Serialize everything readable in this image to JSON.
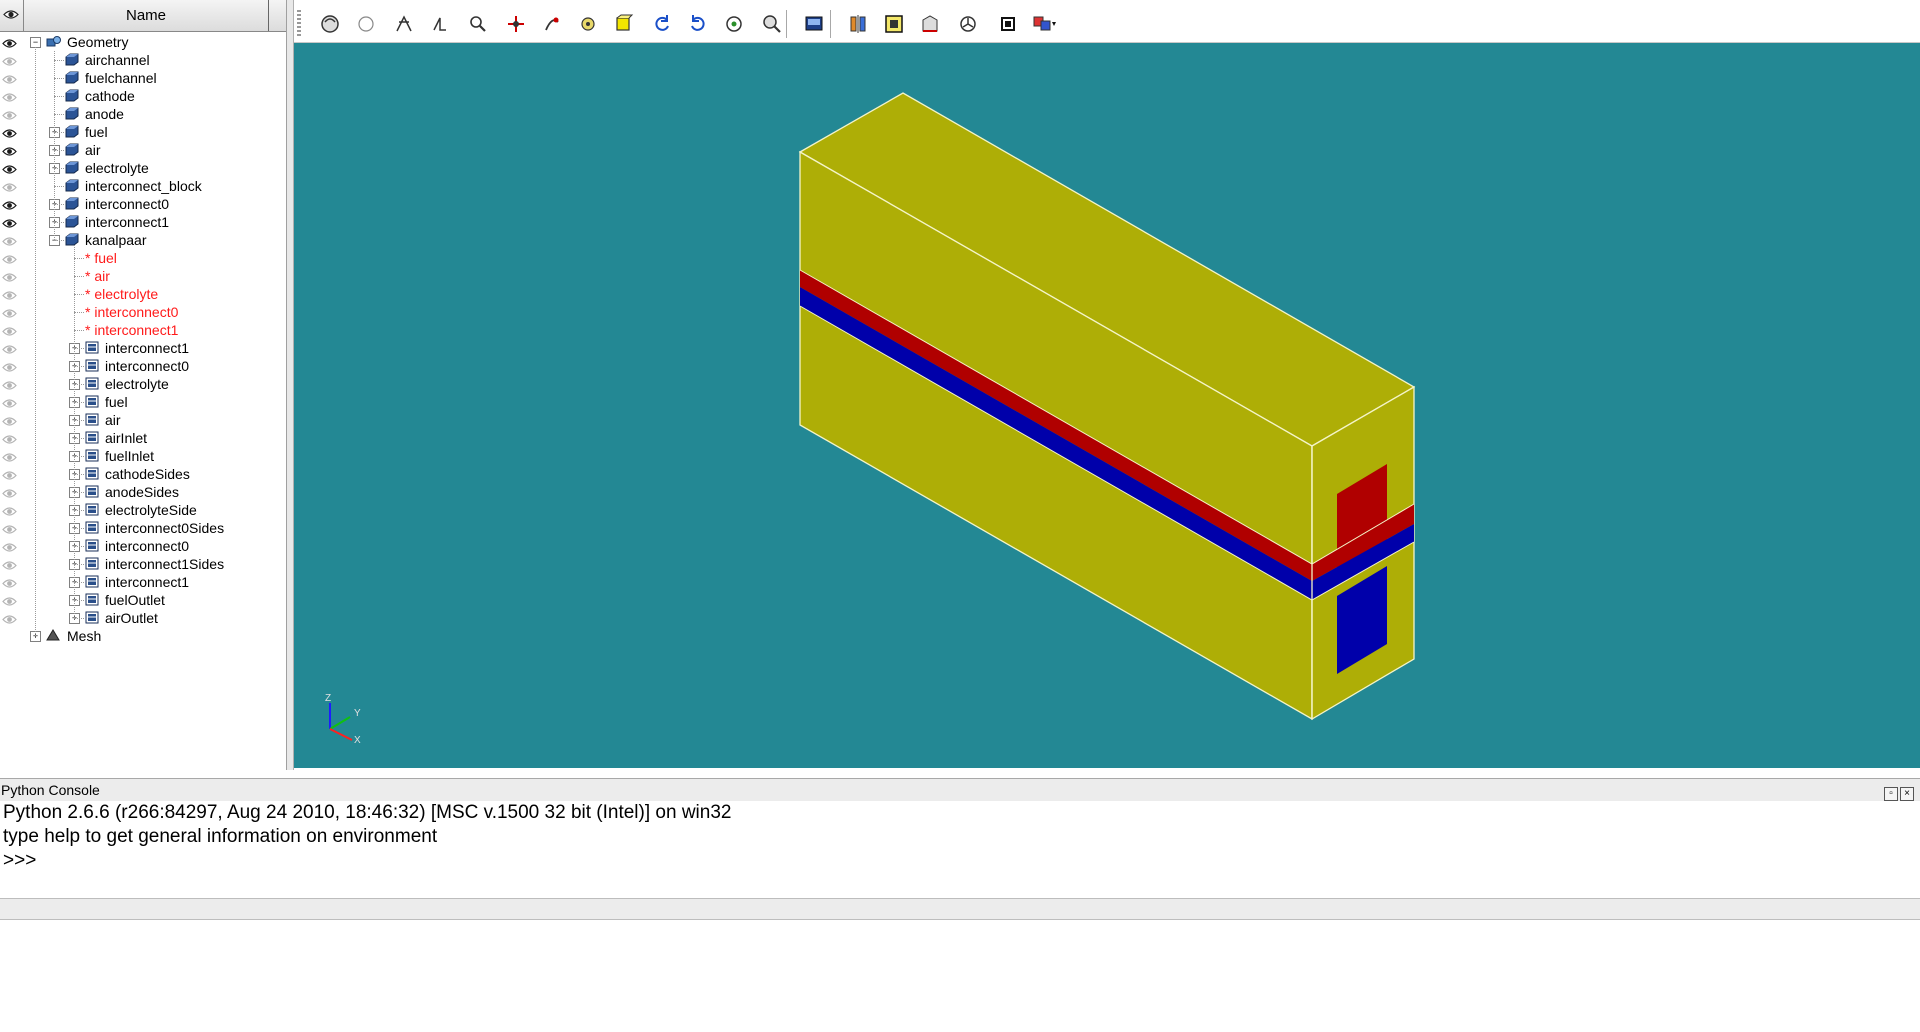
{
  "browser": {
    "header_name": "Name",
    "rows": [
      {
        "label": "Geometry",
        "red": false,
        "eye": "dark"
      },
      {
        "label": "airchannel",
        "red": false,
        "eye": "light"
      },
      {
        "label": "fuelchannel",
        "red": false,
        "eye": "light"
      },
      {
        "label": "cathode",
        "red": false,
        "eye": "light"
      },
      {
        "label": "anode",
        "red": false,
        "eye": "light"
      },
      {
        "label": "fuel",
        "red": false,
        "eye": "dark"
      },
      {
        "label": "air",
        "red": false,
        "eye": "dark"
      },
      {
        "label": "electrolyte",
        "red": false,
        "eye": "dark"
      },
      {
        "label": "interconnect_block",
        "red": false,
        "eye": "light"
      },
      {
        "label": "interconnect0",
        "red": false,
        "eye": "dark"
      },
      {
        "label": "interconnect1",
        "red": false,
        "eye": "dark"
      },
      {
        "label": "kanalpaar",
        "red": false,
        "eye": "light"
      },
      {
        "label": "* fuel",
        "red": true,
        "eye": "light"
      },
      {
        "label": "* air",
        "red": true,
        "eye": "light"
      },
      {
        "label": "* electrolyte",
        "red": true,
        "eye": "light"
      },
      {
        "label": "* interconnect0",
        "red": true,
        "eye": "light"
      },
      {
        "label": "* interconnect1",
        "red": true,
        "eye": "light"
      },
      {
        "label": "interconnect1",
        "red": false,
        "eye": "light"
      },
      {
        "label": "interconnect0",
        "red": false,
        "eye": "light"
      },
      {
        "label": "electrolyte",
        "red": false,
        "eye": "light"
      },
      {
        "label": "fuel",
        "red": false,
        "eye": "light"
      },
      {
        "label": "air",
        "red": false,
        "eye": "light"
      },
      {
        "label": "airInlet",
        "red": false,
        "eye": "light"
      },
      {
        "label": "fuelInlet",
        "red": false,
        "eye": "light"
      },
      {
        "label": "cathodeSides",
        "red": false,
        "eye": "light"
      },
      {
        "label": "anodeSides",
        "red": false,
        "eye": "light"
      },
      {
        "label": "electrolyteSide",
        "red": false,
        "eye": "light"
      },
      {
        "label": "interconnect0Sides",
        "red": false,
        "eye": "light"
      },
      {
        "label": "interconnect0",
        "red": false,
        "eye": "light"
      },
      {
        "label": "interconnect1Sides",
        "red": false,
        "eye": "light"
      },
      {
        "label": "interconnect1",
        "red": false,
        "eye": "light"
      },
      {
        "label": "fuelOutlet",
        "red": false,
        "eye": "light"
      },
      {
        "label": "airOutlet",
        "red": false,
        "eye": "light"
      },
      {
        "label": "Mesh",
        "red": false,
        "eye": "none"
      }
    ]
  },
  "toolbar": {
    "icons": [
      "rotate-view-icon",
      "reset-view-icon",
      "pan-icon",
      "global-pan-icon",
      "zoom-icon",
      "rotation-point-icon",
      "rotate-icon",
      "fit-all-icon",
      "fit-area-icon",
      "rotate-left-icon",
      "rotate-right-icon",
      "reset-icon",
      "zoom-selection-icon",
      "dump-view-icon",
      "clipping-icon",
      "scaling-icon",
      "graduated-axes-icon",
      "trihedron-icon",
      "mode-icon",
      "dropdown-icon"
    ]
  },
  "viewer": {
    "background": "#238894",
    "body_color": "#aeae06",
    "red_color": "#b00000",
    "blue_color": "#0000aa",
    "axis_z": "Z",
    "axis_y": "Y",
    "axis_x": "X"
  },
  "console": {
    "title": "Python Console",
    "lines": [
      "Python 2.6.6 (r266:84297, Aug 24 2010, 18:46:32) [MSC v.1500 32 bit (Intel)] on win32",
      "type help to get general information on environment",
      ">>>"
    ]
  }
}
